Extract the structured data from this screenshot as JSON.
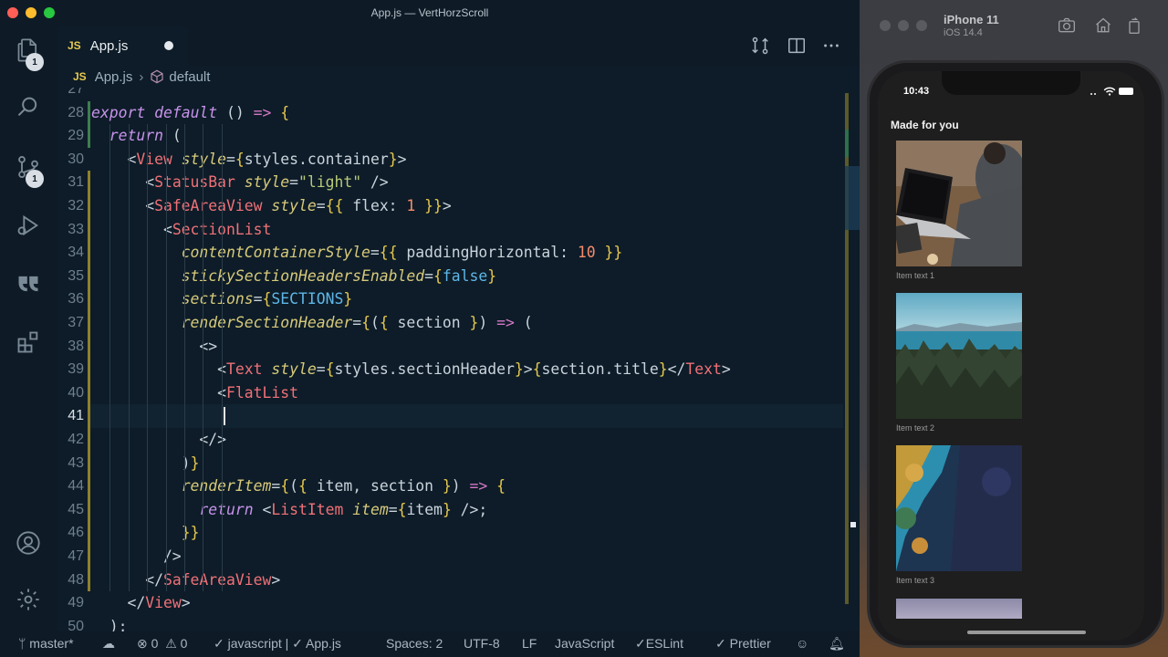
{
  "window": {
    "title": "App.js — VertHorzScroll"
  },
  "activity_bar": {
    "explorer_badge": "1",
    "source_control_badge": "1"
  },
  "tab": {
    "lang": "JS",
    "label": "App.js"
  },
  "breadcrumb": {
    "lang": "JS",
    "file": "App.js",
    "symbol": "default"
  },
  "editor": {
    "lines": [
      {
        "n": "27",
        "text": ""
      },
      {
        "n": "28",
        "text": "export default () => {"
      },
      {
        "n": "29",
        "text": "  return ("
      },
      {
        "n": "30",
        "text": "    <View style={styles.container}>"
      },
      {
        "n": "31",
        "text": "      <StatusBar style=\"light\" />"
      },
      {
        "n": "32",
        "text": "      <SafeAreaView style={{ flex: 1 }}>"
      },
      {
        "n": "33",
        "text": "        <SectionList"
      },
      {
        "n": "34",
        "text": "          contentContainerStyle={{ paddingHorizontal: 10 }}"
      },
      {
        "n": "35",
        "text": "          stickySectionHeadersEnabled={false}"
      },
      {
        "n": "36",
        "text": "          sections={SECTIONS}"
      },
      {
        "n": "37",
        "text": "          renderSectionHeader={({ section }) => ("
      },
      {
        "n": "38",
        "text": "            <>"
      },
      {
        "n": "39",
        "text": "              <Text style={styles.sectionHeader}>{section.title}</Text>"
      },
      {
        "n": "40",
        "text": "              <FlatList"
      },
      {
        "n": "41",
        "text": "              "
      },
      {
        "n": "42",
        "text": "            </>"
      },
      {
        "n": "43",
        "text": "          )}"
      },
      {
        "n": "44",
        "text": "          renderItem={({ item, section }) => {"
      },
      {
        "n": "45",
        "text": "            return <ListItem item={item} />;"
      },
      {
        "n": "46",
        "text": "          }}"
      },
      {
        "n": "47",
        "text": "        />"
      },
      {
        "n": "48",
        "text": "      </SafeAreaView>"
      },
      {
        "n": "49",
        "text": "    </View>"
      },
      {
        "n": "50",
        "text": "  );"
      }
    ],
    "current_line": "41"
  },
  "status_bar": {
    "branch": "master*",
    "errors": "0",
    "warnings": "0",
    "language_check": "javascript | ✓ App.js",
    "spaces": "Spaces: 2",
    "encoding": "UTF-8",
    "eol": "LF",
    "language": "JavaScript",
    "eslint": "ESLint",
    "prettier": "Prettier"
  },
  "simulator": {
    "device": "iPhone 11",
    "os": "iOS 14.4",
    "time": "10:43",
    "section_title": "Made for you",
    "items": [
      {
        "caption": "Item text 1",
        "image": "laptop-photo"
      },
      {
        "caption": "Item text 2",
        "image": "forest-lake-photo"
      },
      {
        "caption": "Item text 3",
        "image": "aerial-coast-photo"
      }
    ]
  },
  "colors": {
    "accent_js": "#e6c84f",
    "editor_bg": "#0d1c28",
    "keyword": "#c792ea",
    "tag": "#f07178"
  }
}
